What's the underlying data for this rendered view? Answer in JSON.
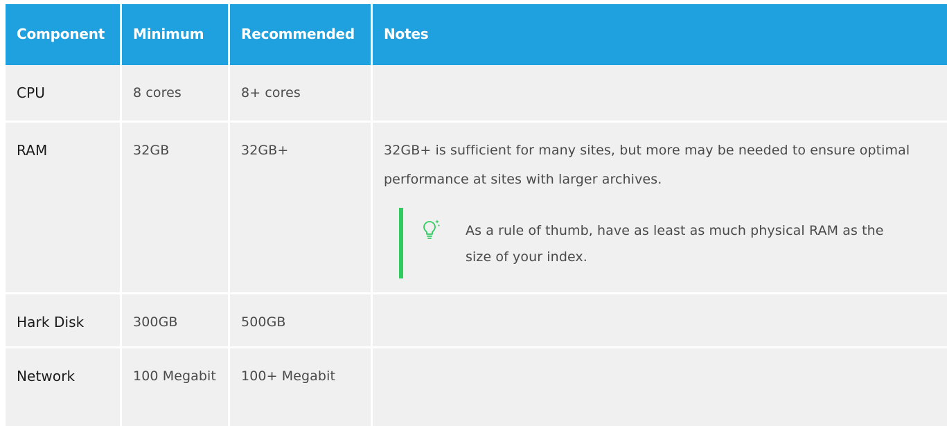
{
  "table": {
    "headers": [
      "Component",
      "Minimum",
      "Recommended",
      "Notes"
    ],
    "rows": [
      {
        "component": "CPU",
        "minimum": "8 cores",
        "recommended": "8+ cores",
        "notes": ""
      },
      {
        "component": "RAM",
        "minimum": "32GB",
        "recommended": "32GB+",
        "notes": "32GB+ is sufficient for many sites, but more may be needed to ensure optimal performance at sites with larger archives.",
        "tip": "As a rule of thumb, have as least as much physical RAM as the size of your index."
      },
      {
        "component": "Hark Disk",
        "minimum": "300GB",
        "recommended": "500GB",
        "notes": ""
      },
      {
        "component": "Network",
        "minimum": "100 Megabit",
        "recommended": "100+ Megabit",
        "notes": ""
      }
    ]
  },
  "colors": {
    "header_bg": "#1fa0df",
    "cell_bg": "#f0f0f0",
    "tip_accent": "#2ecc5e"
  },
  "icons": {
    "tip_icon": "lightbulb-icon"
  }
}
